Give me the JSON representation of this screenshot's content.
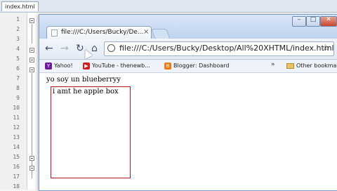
{
  "editor": {
    "tab_label": "index.html",
    "line_numbers": [
      "1",
      "2",
      "3",
      "4",
      "5",
      "6",
      "7",
      "8",
      "9",
      "10",
      "11",
      "12",
      "13",
      "14",
      "15",
      "16",
      "17",
      "18"
    ]
  },
  "browser": {
    "tab_title": "file:///C:/Users/Bucky/De...",
    "tab_close": "×",
    "url": "file:///C:/Users/Bucky/Desktop/All%20XHTML/index.html",
    "bookmarks": [
      {
        "label": "Yahoo!",
        "icon": "yahoo-icon",
        "color": "#6b1f9c"
      },
      {
        "label": "YouTube - thenewb...",
        "icon": "youtube-icon",
        "color": "#cc2020"
      },
      {
        "label": "Blogger: Dashboard",
        "icon": "blogger-icon",
        "color": "#f07a1a"
      }
    ],
    "overflow": "»",
    "other_bookmarks": "Other bookmarks"
  },
  "page": {
    "line1": "yo soy un blueberryy",
    "box_text": "i amt he apple box",
    "box_border_color": "#b3131b"
  }
}
